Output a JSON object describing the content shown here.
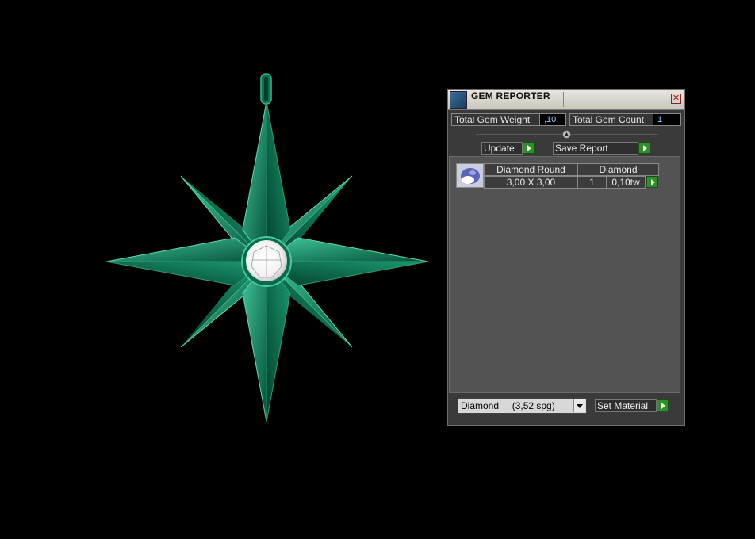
{
  "panel": {
    "title": "GEM REPORTER",
    "close_icon": "close-icon",
    "total_gem_weight_label": "Total Gem Weight",
    "total_gem_weight_value": ",10",
    "total_gem_count_label": "Total Gem Count",
    "total_gem_count_value": "1",
    "update_label": "Update",
    "save_report_label": "Save Report",
    "gem_rows": [
      {
        "shape": "Diamond Round",
        "material": "Diamond",
        "size": "3,00 X 3,00",
        "count": "1",
        "weight": "0,10tw"
      }
    ],
    "material_select_value": "Diamond     (3,52 spg)",
    "set_material_label": "Set Material"
  },
  "viewport": {
    "object": "star-pendant",
    "metal_color": "#0f7a5a",
    "gem_color": "#ffffff"
  }
}
